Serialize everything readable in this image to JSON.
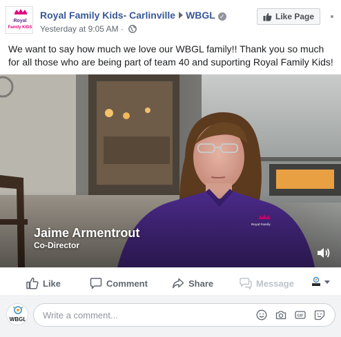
{
  "header": {
    "page_name": "Royal Family Kids- Carlinville",
    "target_page": "WBGL",
    "timestamp": "Yesterday at 9:05 AM",
    "separator": "·",
    "like_page_label": "Like Page",
    "avatar_logo_text_top": "Royal",
    "avatar_logo_text_bottom": "Family KIDS"
  },
  "post": {
    "text": "We want to say how much we love our WBGL family!! Thank you so much for all those who are being part of team 40 and suporting Royal Family Kids!"
  },
  "video": {
    "speaker_name": "Jaime Armentrout",
    "speaker_title": "Co-Director",
    "shirt_logo_text": "Royal Family"
  },
  "actions": {
    "like": "Like",
    "comment": "Comment",
    "share": "Share",
    "message": "Message"
  },
  "composer": {
    "avatar_text": "WBGL",
    "placeholder": "Write a comment...",
    "gif_label": "GIF"
  },
  "colors": {
    "link": "#385898",
    "muted": "#606770",
    "border": "#ccd0d5",
    "shirt": "#4b2a8a"
  }
}
